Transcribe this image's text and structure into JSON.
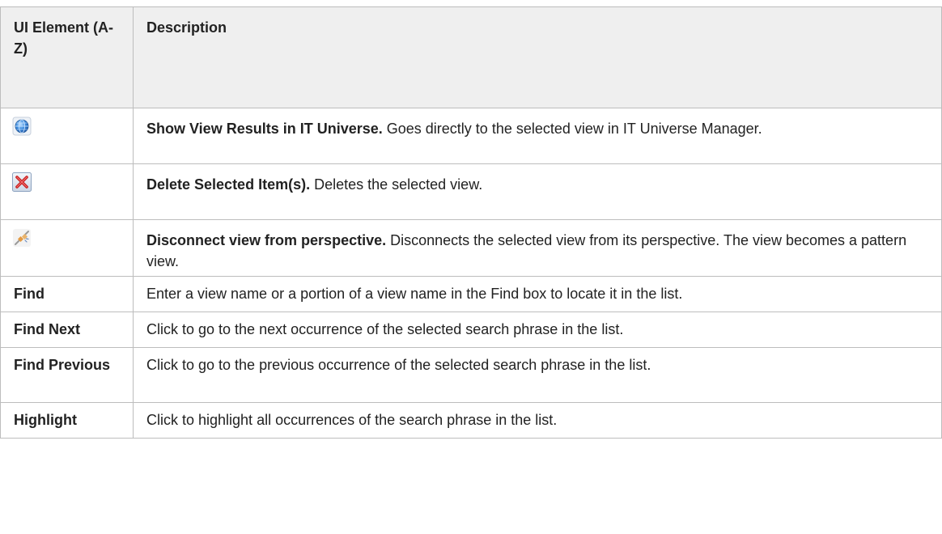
{
  "table": {
    "headers": {
      "element": "UI Element (A-Z)",
      "description": "Description"
    },
    "rows": [
      {
        "icon": "globe-icon",
        "element": "",
        "title": "Show View Results in IT Universe.",
        "text": " Goes directly to the selected view in IT Universe Manager."
      },
      {
        "icon": "delete-red-x-icon",
        "element": "",
        "title": "Delete Selected Item(s).",
        "text": " Deletes the selected view."
      },
      {
        "icon": "disconnect-plug-icon",
        "element": "",
        "title": "Disconnect view from perspective.",
        "text": " Disconnects the selected view from its perspective. The view becomes a pattern view."
      },
      {
        "element": "Find",
        "title": "",
        "text": "Enter a view name or a portion of a view name in the Find box to locate it in the list."
      },
      {
        "element": "Find Next",
        "title": "",
        "text": "Click to go to the next occurrence of the selected search phrase in the list."
      },
      {
        "element": "Find Previous",
        "title": "",
        "text": "Click to go to the previous occurrence of the selected search phrase in the list."
      },
      {
        "element": "Highlight",
        "title": "",
        "text": "Click to highlight all occurrences of the search phrase in the list."
      }
    ]
  }
}
